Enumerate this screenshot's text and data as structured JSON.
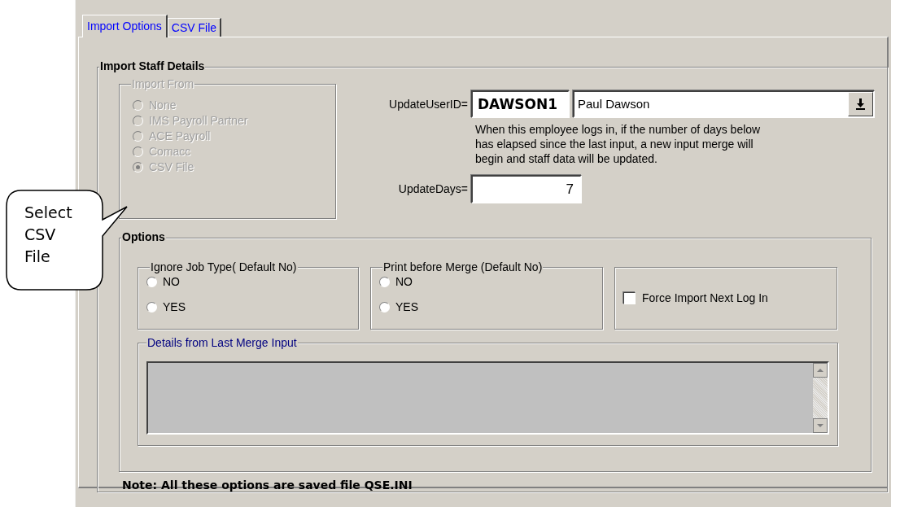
{
  "tabs": [
    {
      "label": "Import Options",
      "selected": true
    },
    {
      "label": "CSV File",
      "selected": false
    }
  ],
  "staff_group": {
    "title": "Import Staff Details",
    "import_from": {
      "title": "Import From",
      "disabled": true,
      "options": [
        {
          "label": "None",
          "selected": false
        },
        {
          "label": "IMS Payroll Partner",
          "selected": false
        },
        {
          "label": "ACE Payroll",
          "selected": false
        },
        {
          "label": "Comacc",
          "selected": false
        },
        {
          "label": "CSV File",
          "selected": true
        }
      ]
    },
    "update_user": {
      "label": "UpdateUserID=",
      "id": "DAWSON1",
      "name": "Paul Dawson"
    },
    "description": "When this employee logs in, if the number of days below has elapsed since the last input, a new input merge will begin and staff data will be updated.",
    "update_days": {
      "label": "UpdateDays=",
      "value": "7"
    }
  },
  "options_group": {
    "title": "Options",
    "ignore_job_type": {
      "title": "Ignore Job Type( Default No)",
      "options": [
        {
          "label": "NO",
          "selected": false
        },
        {
          "label": "YES",
          "selected": false
        }
      ]
    },
    "print_before_merge": {
      "title": "Print before Merge (Default No)",
      "options": [
        {
          "label": "NO",
          "selected": false
        },
        {
          "label": "YES",
          "selected": false
        }
      ]
    },
    "force_import": {
      "label": "Force Import Next Log In",
      "checked": false
    },
    "details": {
      "title": "Details from Last Merge Input"
    }
  },
  "note": "Note: All these options are saved file QSE.INI",
  "callout": "Select CSV File"
}
